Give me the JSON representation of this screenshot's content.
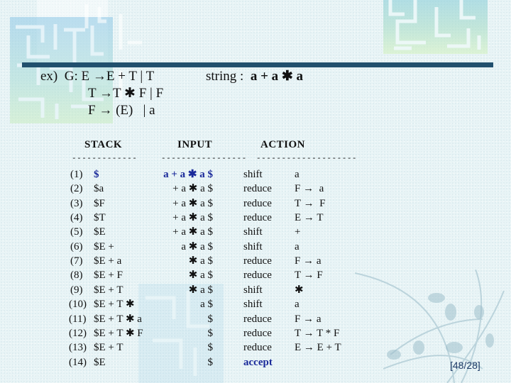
{
  "grammar": {
    "prefix": "ex)  G:",
    "rule1": "E →E + T | T",
    "rule2": "T →T ✱ F | F",
    "rule3": "F → (E)   | a"
  },
  "input_string": {
    "label": "string :",
    "value": "a + a ✱ a"
  },
  "table": {
    "headers": {
      "stack": "STACK",
      "input": "INPUT",
      "action": "ACTION"
    },
    "underlines": {
      "stack": "-------------",
      "input": "-----------------",
      "action": "--------------------"
    },
    "rows": [
      {
        "num": "(1)",
        "stack": "$",
        "input": "a + a ✱ a $",
        "action": "shift",
        "rule": "a",
        "highlight": true
      },
      {
        "num": "(2)",
        "stack": "$a",
        "input": "+ a ✱ a $",
        "action": "reduce",
        "rule": "F →  a"
      },
      {
        "num": "(3)",
        "stack": "$F",
        "input": "+ a ✱ a $",
        "action": "reduce",
        "rule": "T →  F"
      },
      {
        "num": "(4)",
        "stack": "$T",
        "input": "+ a ✱ a $",
        "action": "reduce",
        "rule": "E → T"
      },
      {
        "num": "(5)",
        "stack": "$E",
        "input": "+ a ✱ a $",
        "action": "shift",
        "rule": "+"
      },
      {
        "num": "(6)",
        "stack": "$E +",
        "input": "a ✱ a $",
        "action": "shift",
        "rule": "a"
      },
      {
        "num": "(7)",
        "stack": "$E + a",
        "input": "✱ a $",
        "action": "reduce",
        "rule": "F → a"
      },
      {
        "num": "(8)",
        "stack": "$E + F",
        "input": "✱ a $",
        "action": "reduce",
        "rule": "T → F"
      },
      {
        "num": "(9)",
        "stack": "$E + T",
        "input": "✱ a $",
        "action": "shift",
        "rule": "✱"
      },
      {
        "num": "(10)",
        "stack": "$E + T ✱",
        "input": "a $",
        "action": "shift",
        "rule": "a"
      },
      {
        "num": "(11)",
        "stack": "$E + T ✱ a",
        "input": "$",
        "action": "reduce",
        "rule": "F → a"
      },
      {
        "num": "(12)",
        "stack": "$E + T ✱ F",
        "input": "$",
        "action": "reduce",
        "rule": "T → T * F"
      },
      {
        "num": "(13)",
        "stack": "$E + T",
        "input": "$",
        "action": "reduce",
        "rule": "E → E + T"
      },
      {
        "num": "(14)",
        "stack": "$E",
        "input": "$",
        "action": "accept",
        "rule": "",
        "accept": true
      }
    ]
  },
  "page_number": "[48/28]",
  "colors": {
    "title_bar": "#21506e",
    "highlight_text": "#1a2a9a",
    "page_number": "#1d3a66"
  }
}
